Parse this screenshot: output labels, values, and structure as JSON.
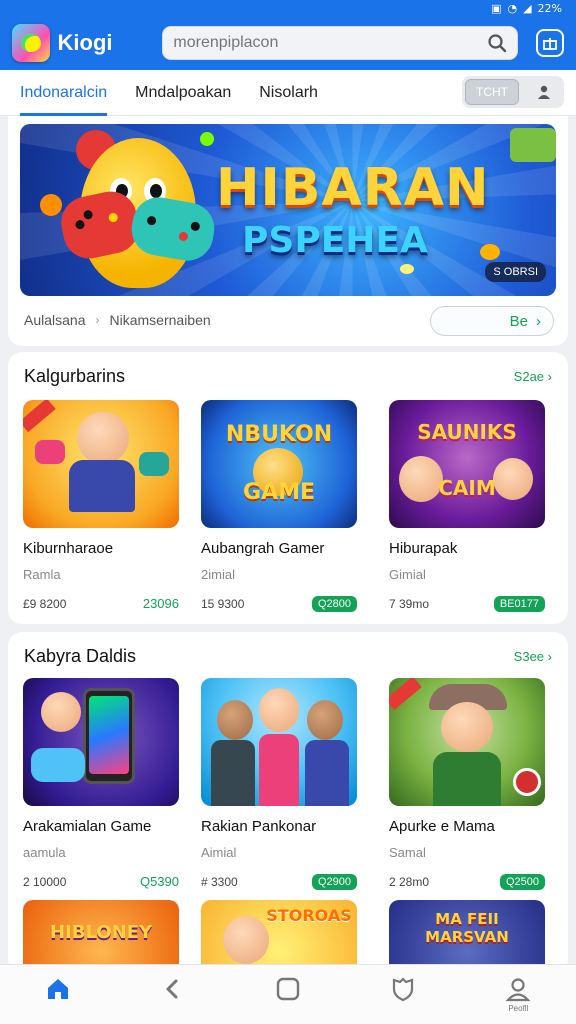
{
  "status_bar": {
    "battery": "22%"
  },
  "app": {
    "title": "Kiogi"
  },
  "search": {
    "placeholder": "morenpiplacon"
  },
  "tabs": [
    {
      "label": "Indonaralcin",
      "active": true
    },
    {
      "label": "Mndalpoakan",
      "active": false
    },
    {
      "label": "Nisolarh",
      "active": false
    }
  ],
  "tab_tools": {
    "pill_label": "ТСНТ"
  },
  "hero": {
    "title_line1": "HIBARAN",
    "title_line2": "PSPEHEA",
    "badge": "S OBRSI",
    "meta_left": "Aulalsana",
    "meta_sep": "›",
    "meta_right": "Nikamsernaiben",
    "button_label": "Be"
  },
  "sections": [
    {
      "title": "Kalgurbarins",
      "more": "S2ae",
      "cards": [
        {
          "name": "Kiburnharaoe",
          "category": "Ramla",
          "downloads": "£9 8200",
          "price": "23096",
          "price_style": "text",
          "thumb_text": ""
        },
        {
          "name": "Aubangrah Gamer",
          "category": "2imial",
          "downloads": "15 9300",
          "price": "Q2800",
          "price_style": "badge",
          "thumb_text": "NBUKON GAME"
        },
        {
          "name": "Hiburapak",
          "category": "Gimial",
          "downloads": "7 39mo",
          "price": "BE0177",
          "price_style": "badge",
          "thumb_text": "SAUNIKS CAIM"
        }
      ]
    },
    {
      "title": "Kabyra Daldis",
      "more": "S3ee",
      "cards": [
        {
          "name": "Arakamialan Game",
          "category": "aamula",
          "downloads": "2 10000",
          "price": "Q5390",
          "price_style": "text",
          "thumb_text": ""
        },
        {
          "name": "Rakian Pankonar",
          "category": "Aimial",
          "downloads": "# 3300",
          "price": "Q2900",
          "price_style": "badge",
          "thumb_text": ""
        },
        {
          "name": "Apurke e Mama",
          "category": "Samal",
          "downloads": "2 28m0",
          "price": "Q2500",
          "price_style": "badge",
          "thumb_text": ""
        }
      ]
    }
  ],
  "partial_row": [
    {
      "thumb_text": "HIBLONEY"
    },
    {
      "thumb_text": "STOROAS"
    },
    {
      "thumb_text": "MA FEII MARSVAN"
    }
  ],
  "bottom_nav": [
    {
      "icon": "home-icon",
      "label": ""
    },
    {
      "icon": "back-icon",
      "label": ""
    },
    {
      "icon": "square-icon",
      "label": ""
    },
    {
      "icon": "shield-icon",
      "label": ""
    },
    {
      "icon": "profile-icon",
      "label": "Peofll"
    }
  ],
  "colors": {
    "primary": "#1a73e8",
    "accent_green": "#12a356"
  }
}
